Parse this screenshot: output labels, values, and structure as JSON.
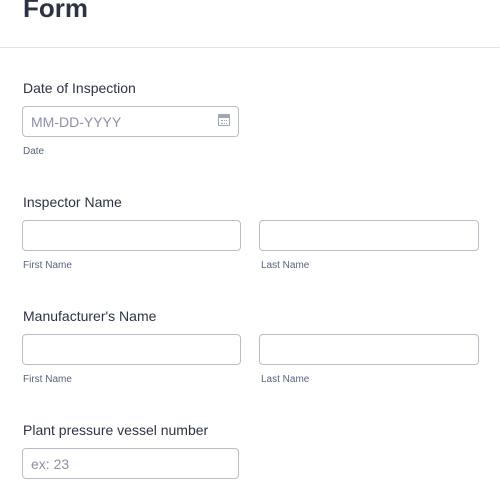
{
  "form": {
    "title": "Form"
  },
  "date_of_inspection": {
    "label": "Date of Inspection",
    "placeholder": "MM-DD-YYYY",
    "value": "",
    "sublabel": "Date",
    "icon": "calendar-icon"
  },
  "inspector_name": {
    "label": "Inspector Name",
    "first": {
      "value": "",
      "sublabel": "First Name"
    },
    "last": {
      "value": "",
      "sublabel": "Last Name"
    }
  },
  "manufacturer_name": {
    "label": "Manufacturer's Name",
    "first": {
      "value": "",
      "sublabel": "First Name"
    },
    "last": {
      "value": "",
      "sublabel": "Last Name"
    }
  },
  "vessel_number": {
    "label": "Plant pressure vessel number",
    "placeholder": "ex: 23",
    "value": ""
  }
}
